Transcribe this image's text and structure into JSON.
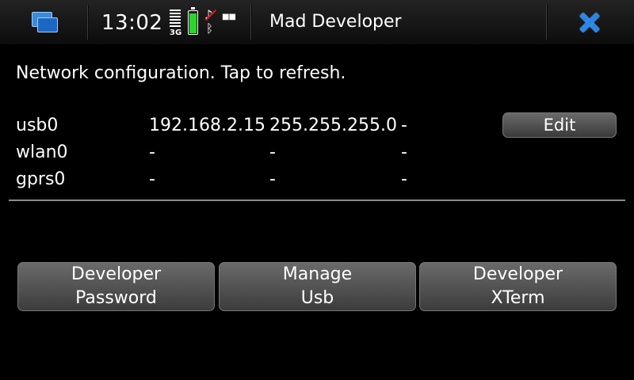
{
  "statusbar": {
    "clock": "13:02",
    "network_type": "3G",
    "app_title": "Mad Developer",
    "battery_level": 0.85
  },
  "heading": "Network configuration. Tap to refresh.",
  "interfaces": [
    {
      "name": "usb0",
      "ip": "192.168.2.15",
      "netmask": "255.255.255.0",
      "gateway": "-"
    },
    {
      "name": "wlan0",
      "ip": "-",
      "netmask": "-",
      "gateway": "-"
    },
    {
      "name": "gprs0",
      "ip": "-",
      "netmask": "-",
      "gateway": "-"
    }
  ],
  "edit_label": "Edit",
  "buttons": [
    {
      "line1": "Developer",
      "line2": "Password"
    },
    {
      "line1": "Manage",
      "line2": "Usb"
    },
    {
      "line1": "Developer",
      "line2": "XTerm"
    }
  ],
  "colors": {
    "accent": "#2a86e6",
    "battery": "#29d629",
    "button_top": "#6a6a6a",
    "button_bottom": "#3c3c3c"
  }
}
